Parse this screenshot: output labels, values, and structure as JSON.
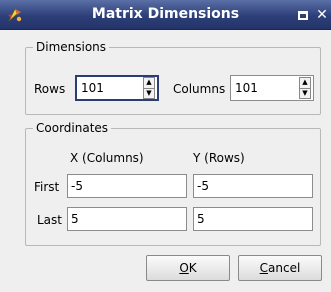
{
  "window": {
    "title": "Matrix Dimensions",
    "app_icon": "app-sparkle-icon",
    "maximize_icon": "maximize-icon",
    "close_glyph": "✕"
  },
  "dimensions": {
    "group_title": "Dimensions",
    "rows_label": "Rows",
    "rows_value": "101",
    "columns_label": "Columns",
    "columns_value": "101"
  },
  "coordinates": {
    "group_title": "Coordinates",
    "x_header": "X (Columns)",
    "y_header": "Y (Rows)",
    "first_label": "First",
    "first_x": "-5",
    "first_y": "-5",
    "last_label": "Last",
    "last_x": "5",
    "last_y": "5"
  },
  "buttons": {
    "ok_mnemonic": "O",
    "ok_rest": "K",
    "cancel_mnemonic": "C",
    "cancel_rest": "ancel"
  },
  "colors": {
    "titlebar": "#2d3f78",
    "dialog_bg": "#efefef",
    "focus_border": "#2c3d73"
  }
}
